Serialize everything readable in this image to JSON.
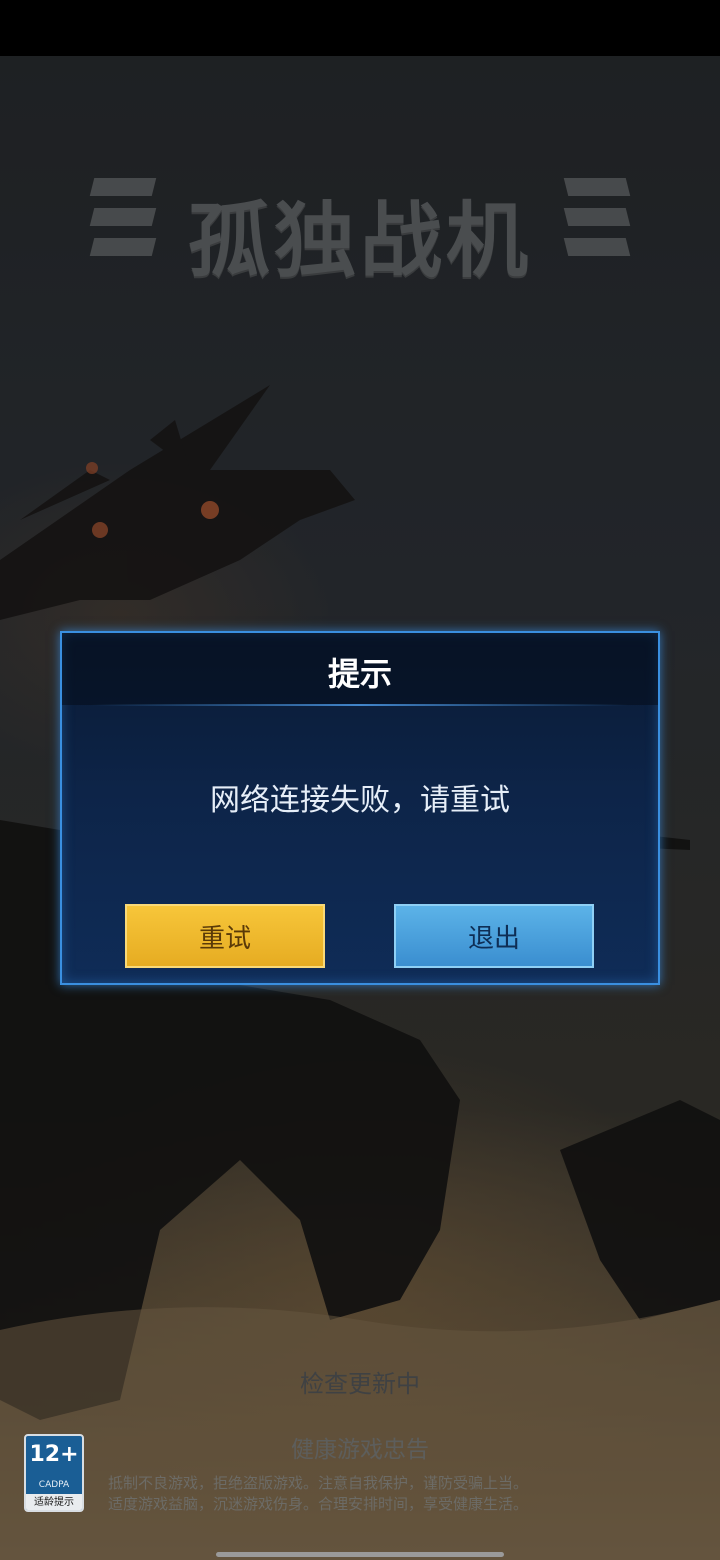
{
  "game": {
    "logo_title": "孤独战机"
  },
  "dialog": {
    "title": "提示",
    "message": "网络连接失败，请重试",
    "retry_label": "重试",
    "exit_label": "退出"
  },
  "loading": {
    "status": "检查更新中"
  },
  "health_advisory": {
    "title": "健康游戏忠告",
    "line1": "抵制不良游戏，拒绝盗版游戏。注意自我保护，谨防受骗上当。",
    "line2": "适度游戏益脑，沉迷游戏伤身。合理安排时间，享受健康生活。"
  },
  "age_rating": {
    "age": "12+",
    "org": "CADPA",
    "tip": "适龄提示"
  },
  "colors": {
    "dialog_border": "#3a8fe0",
    "retry_button": "#f0b82e",
    "exit_button": "#4aa3de"
  },
  "icons": [
    "fighter-jet-silhouette",
    "mech-robot-silhouette"
  ]
}
